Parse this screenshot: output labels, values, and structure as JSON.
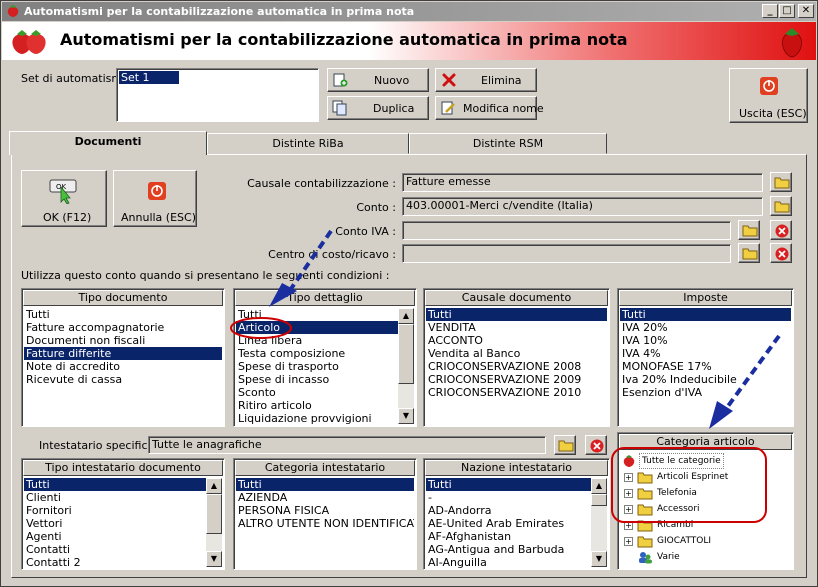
{
  "window": {
    "title": "Automatismi per la contabilizzazione automatica in prima nota",
    "banner_title": "Automatismi per la contabilizzazione automatica in prima nota",
    "controls": {
      "minimize": "_",
      "maximize": "□",
      "close": "✕"
    }
  },
  "set": {
    "label": "Set di automatismi :",
    "items": [
      "Set 1"
    ],
    "buttons": {
      "nuovo": "Nuovo",
      "elimina": "Elimina",
      "duplica": "Duplica",
      "modifica": "Modifica nome"
    }
  },
  "uscita": "Uscita (ESC)",
  "tabs": [
    "Documenti",
    "Distinte RiBa",
    "Distinte RSM"
  ],
  "ok_button": {
    "icon_text": "OK",
    "label": "OK (F12)"
  },
  "annulla_button": "Annulla (ESC)",
  "fields": {
    "causale": {
      "label": "Causale contabilizzazione :",
      "value": "Fatture emesse"
    },
    "conto": {
      "label": "Conto :",
      "value": "403.00001-Merci c/vendite (Italia)"
    },
    "conto_iva": {
      "label": "Conto IVA :",
      "value": ""
    },
    "centro": {
      "label": "Centro di costo/ricavo :",
      "value": ""
    }
  },
  "conditions_label": "Utilizza questo conto quando si presentano le seguenti condizioni :",
  "lists": {
    "tipo_documento": {
      "header": "Tipo documento",
      "items": [
        "Tutti",
        "Fatture accompagnatorie",
        "Documenti non fiscali",
        "Fatture differite",
        "Note di accredito",
        "Ricevute di cassa"
      ],
      "selected": 3
    },
    "tipo_dettaglio": {
      "header": "Tipo dettaglio",
      "items": [
        "Tutti",
        "Articolo",
        "Linea libera",
        "Testa composizione",
        "Spese di trasporto",
        "Spese di incasso",
        "Sconto",
        "Ritiro articolo",
        "Liquidazione provvigioni"
      ],
      "selected": 1
    },
    "causale_documento": {
      "header": "Causale documento",
      "items": [
        "Tutti",
        "VENDITA",
        "ACCONTO",
        "Vendita al Banco",
        "CRIOCONSERVAZIONE 2008",
        "CRIOCONSERVAZIONE 2009",
        "CRIOCONSERVAZIONE 2010"
      ],
      "selected": 0
    },
    "imposte": {
      "header": "Imposte",
      "items": [
        "Tutti",
        "IVA 20%",
        "IVA 10%",
        "IVA 4%",
        "MONOFASE 17%",
        "Iva 20% Indeducibile",
        "Esenzion d'IVA"
      ],
      "selected": 0
    },
    "tipo_intestatario": {
      "header": "Tipo intestatario documento",
      "items": [
        "Tutti",
        "Clienti",
        "Fornitori",
        "Vettori",
        "Agenti",
        "Contatti",
        "Contatti 2"
      ],
      "selected": 0
    },
    "categoria_intestatario": {
      "header": "Categoria intestatario",
      "items": [
        "Tutti",
        "AZIENDA",
        "PERSONA FISICA",
        "ALTRO UTENTE NON IDENTIFICAT"
      ],
      "selected": 0
    },
    "nazione_intestatario": {
      "header": "Nazione intestatario",
      "items": [
        "Tutti",
        "-",
        "AD-Andorra",
        "AE-United Arab Emirates",
        "AF-Afghanistan",
        "AG-Antigua and Barbuda",
        "AI-Anguilla"
      ],
      "selected": 0
    }
  },
  "intestatario": {
    "label": "Intestatario specifico :",
    "value": "Tutte le anagrafiche"
  },
  "categoria_articolo": {
    "header": "Categoria articolo",
    "root": "Tutte le categorie",
    "children": [
      "Articoli Esprinet",
      "Telefonia",
      "Accessori",
      "Ricambi",
      "GIOCATTOLI",
      "Varie"
    ]
  },
  "colors": {
    "selection": "#0a246a",
    "annotation_red": "#cc0000",
    "annotation_blue": "#1a2ea0"
  }
}
